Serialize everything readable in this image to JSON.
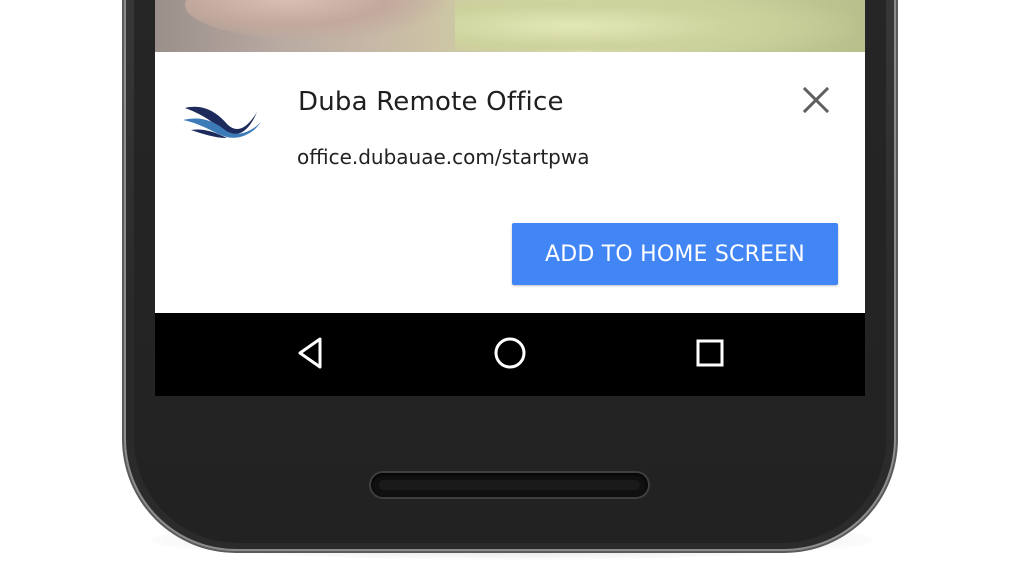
{
  "install_banner": {
    "app_name": "Duba Remote Office",
    "app_url": "office.dubauae.com/startpwa",
    "add_button_label": "ADD TO HOME SCREEN",
    "close_icon": "close-icon",
    "app_icon": "duba-logo-icon"
  },
  "nav_bar": {
    "back_icon": "back-triangle-icon",
    "home_icon": "home-circle-icon",
    "recents_icon": "recents-square-icon"
  },
  "colors": {
    "accent": "#4285f4",
    "banner_bg": "#ffffff",
    "nav_bar_bg": "#000000",
    "logo_navy": "#1d2a5c",
    "logo_blue": "#3d7bb8"
  }
}
